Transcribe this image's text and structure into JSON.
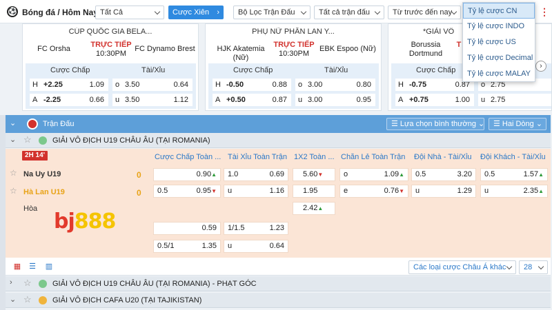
{
  "topbar": {
    "breadcrumb": "Bóng đá / Hôm Nay",
    "filter_all": "Tất Cả",
    "parlay_button": "Cược Xiên",
    "match_filter": "Bộ Lọc Trận Đấu",
    "all_matches": "Tất cả trận đấu",
    "sort": "Từ trước đến nay"
  },
  "odds_menu": {
    "items": [
      "Tỷ lệ cược CN",
      "Tỷ lệ cược INDO",
      "Tỷ lệ cược US",
      "Tỷ lệ cược Decimal",
      "Tỷ lệ cược MALAY"
    ],
    "selected_index": 0
  },
  "cards": [
    {
      "league": "CÚP QUỐC GIA BELA...",
      "home": "FC Orsha",
      "away": "FC Dynamo Brest",
      "status": "TRỰC TIẾP",
      "time": "10:30PM",
      "hdr_hcap": "Cược Chấp",
      "hdr_ou": "Tài/Xỉu",
      "rows": [
        {
          "side": "H",
          "hcap": "+2.25",
          "hodds": "1.09",
          "ou_side": "o",
          "ou": "3.50",
          "ouodds": "0.64"
        },
        {
          "side": "A",
          "hcap": "-2.25",
          "hodds": "0.66",
          "ou_side": "u",
          "ou": "3.50",
          "ouodds": "1.12"
        }
      ]
    },
    {
      "league": "PHỤ NỮ PHẦN LAN Y...",
      "home": "HJK Akatemia (Nữ)",
      "away": "EBK Espoo (Nữ)",
      "status": "TRỰC TIẾP",
      "time": "10:30PM",
      "hdr_hcap": "Cược Chấp",
      "hdr_ou": "Tài/Xỉu",
      "rows": [
        {
          "side": "H",
          "hcap": "-0.50",
          "hodds": "0.88",
          "ou_side": "o",
          "ou": "3.00",
          "ouodds": "0.80"
        },
        {
          "side": "A",
          "hcap": "+0.50",
          "hodds": "0.87",
          "ou_side": "u",
          "ou": "3.00",
          "ouodds": "0.95"
        }
      ]
    },
    {
      "league": "*GIẢI VÔ",
      "home": "Borussia Dortmund",
      "away": "",
      "status": "T",
      "time": "",
      "hdr_hcap": "Cược Chấp",
      "hdr_ou": "",
      "rows": [
        {
          "side": "H",
          "hcap": "-0.75",
          "hodds": "0.87",
          "ou_side": "o",
          "ou": "2.75",
          "ouodds": ""
        },
        {
          "side": "A",
          "hcap": "+0.75",
          "hodds": "1.00",
          "ou_side": "u",
          "ou": "2.75",
          "ouodds": ""
        }
      ]
    }
  ],
  "panel": {
    "title": "Trận Đấu",
    "view_select": "Lựa chọn bình thường",
    "line_select": "Hai Dòng"
  },
  "league_rows": [
    {
      "name": "GIẢI VÔ ĐỊCH U19 CHÂU ÂU (TẠI ROMANIA)",
      "chev": "⌄"
    },
    {
      "name": "GIẢI VÔ ĐỊCH U19 CHÂU ÂU (TẠI ROMANIA) - PHẠT GÓC",
      "chev": "›"
    },
    {
      "name": "GIẢI VÔ ĐỊCH CAFA U20 (TẠI TAJIKISTAN)",
      "chev": "⌄"
    }
  ],
  "match": {
    "period": "2H 14'",
    "home": "Na Uy U19",
    "home_score": "0",
    "away": "Hà Lan U19",
    "away_score": "0",
    "draw": "Hòa",
    "columns": [
      "Cược Chấp Toàn ...",
      "Tài Xỉu Toàn Trận",
      "1X2 Toàn ...",
      "Chẵn Lẻ Toàn Trận",
      "Đội Nhà - Tài/Xỉu",
      "Đội Khách - Tài/Xỉu"
    ],
    "hcap": [
      {
        "l": "",
        "r": "0.90",
        "t": "up"
      },
      {
        "l": "0.5",
        "r": "0.95",
        "t": "dn"
      },
      {
        "l": "",
        "r": "0.59",
        "t": ""
      },
      {
        "l": "0.5/1",
        "r": "1.35",
        "t": ""
      }
    ],
    "ou": [
      {
        "l": "1.0",
        "r": "0.69"
      },
      {
        "l": "u",
        "r": "1.16"
      },
      {
        "l": "1/1.5",
        "r": "1.23"
      },
      {
        "l": "u",
        "r": "0.64"
      }
    ],
    "x12": [
      {
        "v": "5.60",
        "t": "dn"
      },
      {
        "v": "1.95",
        "t": ""
      },
      {
        "v": "2.42",
        "t": "up"
      }
    ],
    "oe": [
      {
        "l": "o",
        "r": "1.09",
        "t": "up"
      },
      {
        "l": "e",
        "r": "0.76",
        "t": "dn"
      }
    ],
    "home_ou": [
      {
        "l": "0.5",
        "r": "3.20"
      },
      {
        "l": "u",
        "r": "1.29"
      }
    ],
    "away_ou": [
      {
        "l": "0.5",
        "r": "1.57",
        "t": "up"
      },
      {
        "l": "u",
        "r": "2.35",
        "t": "up"
      }
    ]
  },
  "footer": {
    "more_bets": "Các loại cược Châu Á khác",
    "count": "28"
  },
  "logo": {
    "text": "bj888"
  }
}
